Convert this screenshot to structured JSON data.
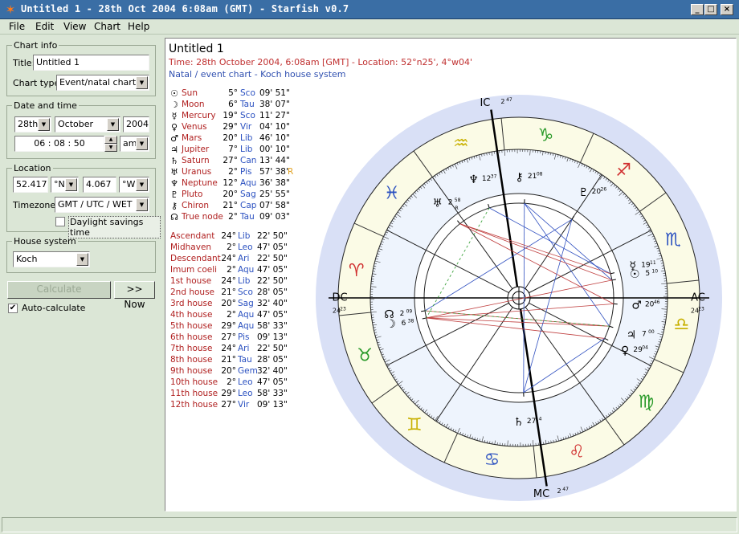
{
  "window": {
    "title": "Untitled 1 - 28th Oct 2004 6:08am (GMT) - Starfish v0.7",
    "minimize": "_",
    "maximize": "□",
    "close": "×"
  },
  "menu": [
    "File",
    "Edit",
    "View",
    "Chart",
    "Help"
  ],
  "chart_info": {
    "legend": "Chart info",
    "title_label": "Title:",
    "title_value": "Untitled 1",
    "type_label": "Chart type:",
    "type_value": "Event/natal chart"
  },
  "date_time": {
    "legend": "Date and time",
    "day": "28th",
    "month": "October",
    "year": "2004",
    "time": "06 : 08 : 50",
    "ampm": "am"
  },
  "location": {
    "legend": "Location",
    "lat": "52.417",
    "lat_dir": "°N",
    "lon": "4.067",
    "lon_dir": "°W",
    "tz_label": "Timezone:",
    "tz_value": "GMT / UTC / WET",
    "dst_label": "Daylight savings time",
    "dst_checked": false
  },
  "house_system": {
    "legend": "House system",
    "value": "Koch"
  },
  "buttons": {
    "calculate": "Calculate",
    "now": ">> Now",
    "auto_label": "Auto-calculate",
    "auto_checked": true
  },
  "chart": {
    "title": "Untitled 1",
    "line1": "Time: 28th October 2004, 6:08am [GMT]  -  Location: 52°n25', 4°w04'",
    "line2": "Natal / event chart  -  Koch house system"
  },
  "planets": [
    {
      "glyph": "☉",
      "name": "Sun",
      "deg": "5°",
      "sign": "Sco",
      "min": "09' 51\"",
      "retro": ""
    },
    {
      "glyph": "☽",
      "name": "Moon",
      "deg": "6°",
      "sign": "Tau",
      "min": "38' 07\"",
      "retro": ""
    },
    {
      "glyph": "☿",
      "name": "Mercury",
      "deg": "19°",
      "sign": "Sco",
      "min": "11' 27\"",
      "retro": ""
    },
    {
      "glyph": "♀",
      "name": "Venus",
      "deg": "29°",
      "sign": "Vir",
      "min": "04' 10\"",
      "retro": ""
    },
    {
      "glyph": "♂",
      "name": "Mars",
      "deg": "20°",
      "sign": "Lib",
      "min": "46' 10\"",
      "retro": ""
    },
    {
      "glyph": "♃",
      "name": "Jupiter",
      "deg": "7°",
      "sign": "Lib",
      "min": "00' 10\"",
      "retro": ""
    },
    {
      "glyph": "♄",
      "name": "Saturn",
      "deg": "27°",
      "sign": "Can",
      "min": "13' 44\"",
      "retro": ""
    },
    {
      "glyph": "♅",
      "name": "Uranus",
      "deg": "2°",
      "sign": "Pis",
      "min": "57' 38\"",
      "retro": "R"
    },
    {
      "glyph": "♆",
      "name": "Neptune",
      "deg": "12°",
      "sign": "Aqu",
      "min": "36' 38\"",
      "retro": ""
    },
    {
      "glyph": "♇",
      "name": "Pluto",
      "deg": "20°",
      "sign": "Sag",
      "min": "25' 55\"",
      "retro": ""
    },
    {
      "glyph": "⚷",
      "name": "Chiron",
      "deg": "21°",
      "sign": "Cap",
      "min": "07' 58\"",
      "retro": ""
    },
    {
      "glyph": "☊",
      "name": "True node",
      "deg": "2°",
      "sign": "Tau",
      "min": "09' 03\"",
      "retro": ""
    }
  ],
  "houses": [
    {
      "name": "Ascendant",
      "deg": "24°",
      "sign": "Lib",
      "min": "22' 50\""
    },
    {
      "name": "Midhaven",
      "deg": "2°",
      "sign": "Leo",
      "min": "47' 05\""
    },
    {
      "name": "Descendant",
      "deg": "24°",
      "sign": "Ari",
      "min": "22' 50\""
    },
    {
      "name": "Imum coeli",
      "deg": "2°",
      "sign": "Aqu",
      "min": "47' 05\""
    },
    {
      "name": "1st house",
      "deg": "24°",
      "sign": "Lib",
      "min": "22' 50\""
    },
    {
      "name": "2nd house",
      "deg": "21°",
      "sign": "Sco",
      "min": "28' 05\""
    },
    {
      "name": "3rd house",
      "deg": "20°",
      "sign": "Sag",
      "min": "32' 40\""
    },
    {
      "name": "4th house",
      "deg": "2°",
      "sign": "Aqu",
      "min": "47' 05\""
    },
    {
      "name": "5th house",
      "deg": "29°",
      "sign": "Aqu",
      "min": "58' 33\""
    },
    {
      "name": "6th house",
      "deg": "27°",
      "sign": "Pis",
      "min": "09' 13\""
    },
    {
      "name": "7th house",
      "deg": "24°",
      "sign": "Ari",
      "min": "22' 50\""
    },
    {
      "name": "8th house",
      "deg": "21°",
      "sign": "Tau",
      "min": "28' 05\""
    },
    {
      "name": "9th house",
      "deg": "20°",
      "sign": "Gem",
      "min": "32' 40\""
    },
    {
      "name": "10th house",
      "deg": "2°",
      "sign": "Leo",
      "min": "47' 05\""
    },
    {
      "name": "11th house",
      "deg": "29°",
      "sign": "Leo",
      "min": "58' 33\""
    },
    {
      "name": "12th house",
      "deg": "27°",
      "sign": "Vir",
      "min": "09' 13\""
    }
  ],
  "wheel": {
    "mc_label": "MC",
    "mc_deg": "2",
    "mc_min": "47",
    "ic_label": "IC",
    "ic_deg": "2",
    "ic_min": "47",
    "ac_label": "AC",
    "ac_deg": "24",
    "ac_min": "23",
    "dc_label": "DC",
    "dc_deg": "24",
    "dc_min": "23",
    "outer_color": "#d9e0f6",
    "zodiac_color": "#fbfbe6",
    "house_ring_color": "#eef4fd",
    "sign_colors": {
      "fire": "#d03030",
      "earth": "#2a9a2a",
      "air": "#c8b000",
      "water": "#2a50c0"
    },
    "planet_labels": [
      {
        "glyph": "♃",
        "deg": "7",
        "min": "00"
      },
      {
        "glyph": "♀",
        "deg": "29",
        "min": "04"
      },
      {
        "glyph": "♂",
        "deg": "20",
        "min": "46"
      },
      {
        "glyph": "☉",
        "deg": "5",
        "min": "10"
      },
      {
        "glyph": "☿",
        "deg": "19",
        "min": "11"
      },
      {
        "glyph": "♇",
        "deg": "20",
        "min": "26"
      },
      {
        "glyph": "⚷",
        "deg": "21",
        "min": "08"
      },
      {
        "glyph": "♆",
        "deg": "12",
        "min": "37"
      },
      {
        "glyph": "♅",
        "deg": "2",
        "min": "58",
        "retro": "R"
      },
      {
        "glyph": "☽",
        "deg": "6",
        "min": "38"
      },
      {
        "glyph": "☊",
        "deg": "2",
        "min": "09"
      },
      {
        "glyph": "♄",
        "deg": "27",
        "min": "14"
      }
    ]
  }
}
